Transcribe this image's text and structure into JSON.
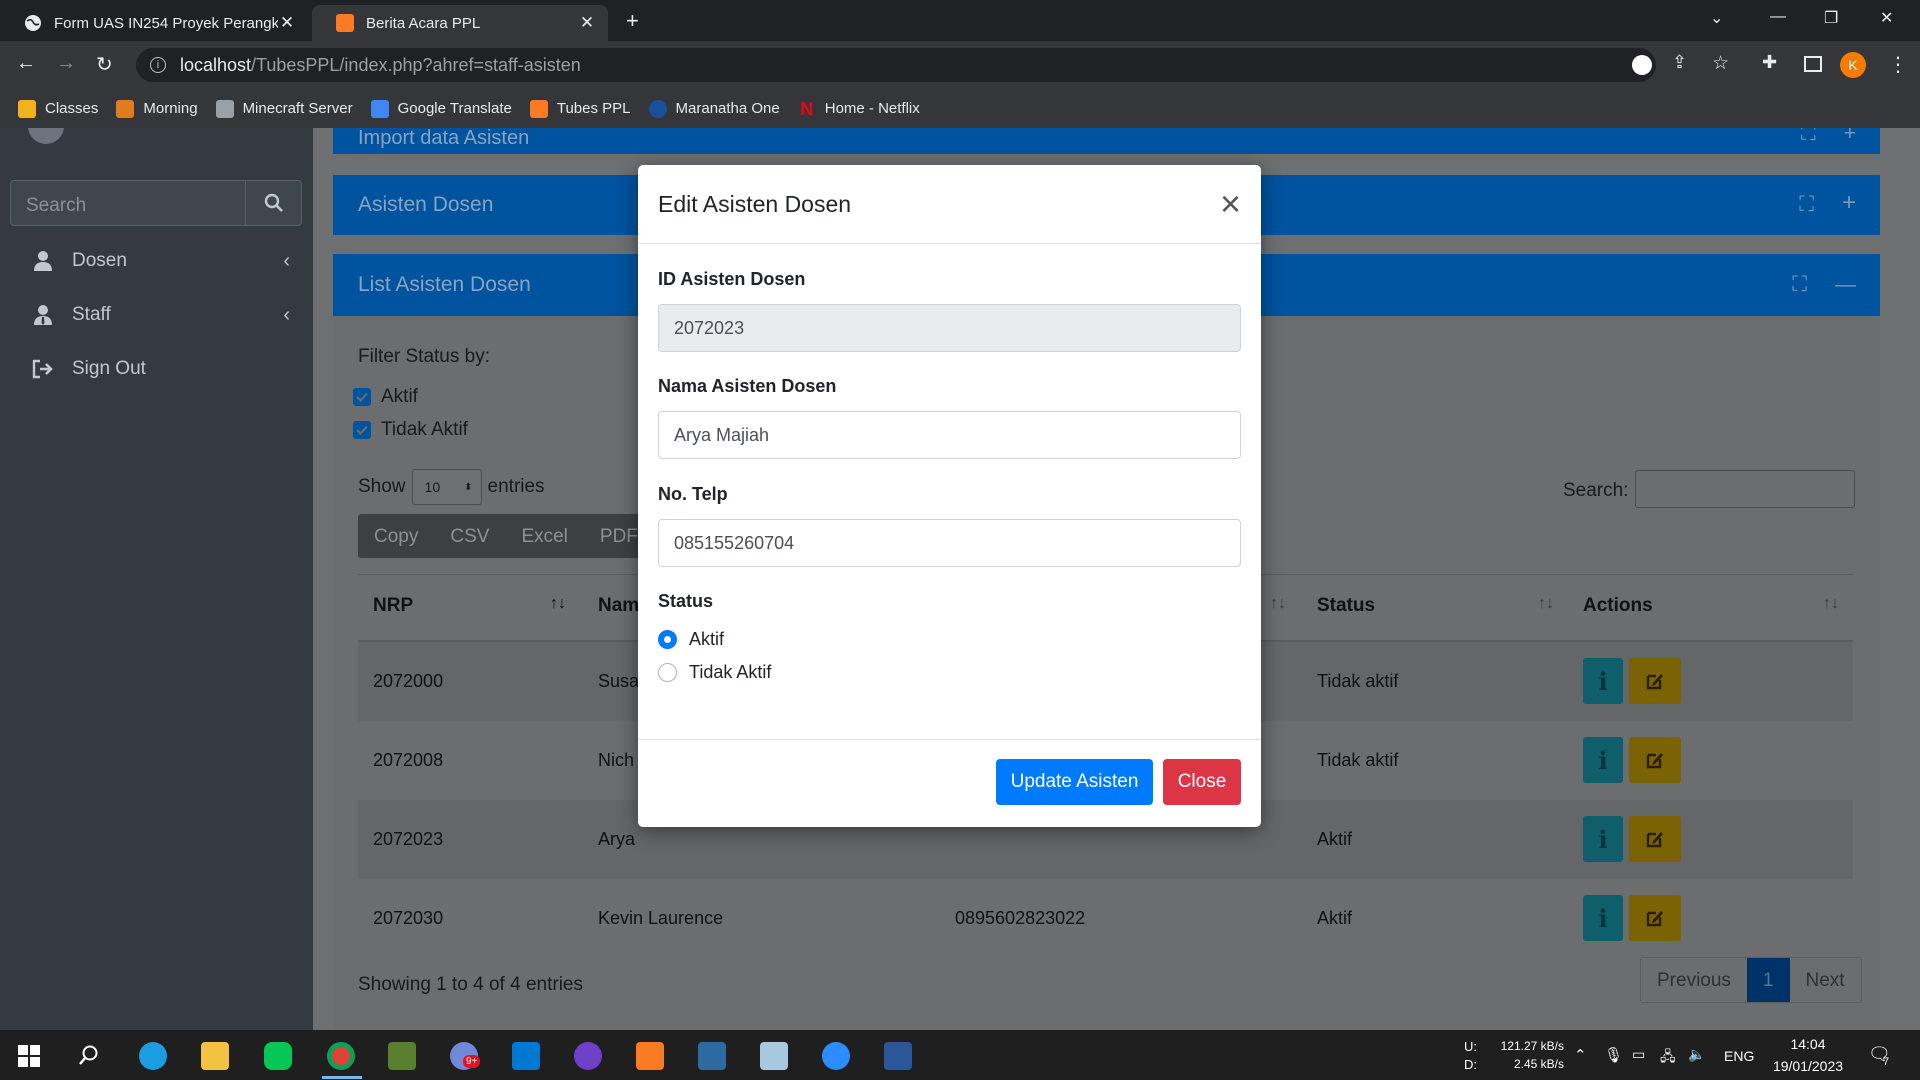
{
  "browser": {
    "tabs": [
      {
        "title": "Form UAS IN254 Proyek Perangk",
        "active": false
      },
      {
        "title": "Berita Acara PPL",
        "active": true
      }
    ],
    "url_host": "localhost",
    "url_path": "/TubesPPL/index.php?ahref=staff-asisten",
    "profile_initial": "K",
    "bookmarks": [
      "Classes",
      "Morning",
      "Minecraft Server",
      "Google Translate",
      "Tubes PPL",
      "Maranatha One",
      "Home - Netflix"
    ]
  },
  "sidebar": {
    "search_placeholder": "Search",
    "items": [
      {
        "label": "Dosen",
        "icon": "user-icon"
      },
      {
        "label": "Staff",
        "icon": "user-tie-icon"
      },
      {
        "label": "Sign Out",
        "icon": "sign-out-icon"
      }
    ]
  },
  "cards": {
    "import_title": "Import data Asisten",
    "asisten_title": "Asisten Dosen",
    "list_title": "List Asisten Dosen"
  },
  "list": {
    "filter_label": "Filter Status by:",
    "filters": [
      "Aktif",
      "Tidak Aktif"
    ],
    "show_label": "Show",
    "entries_value": "10",
    "entries_label": "entries",
    "search_label": "Search:",
    "export_buttons": [
      "Copy",
      "CSV",
      "Excel",
      "PDF"
    ],
    "columns": [
      "NRP",
      "Nama",
      "",
      "Status",
      "Actions"
    ],
    "rows": [
      {
        "nrp": "2072000",
        "nama": "Susa",
        "telp": "",
        "status": "Tidak aktif"
      },
      {
        "nrp": "2072008",
        "nama": "Nich",
        "telp": "",
        "status": "Tidak aktif"
      },
      {
        "nrp": "2072023",
        "nama": "Arya",
        "telp": "",
        "status": "Aktif"
      },
      {
        "nrp": "2072030",
        "nama": "Kevin Laurence",
        "telp": "0895602823022",
        "status": "Aktif"
      }
    ],
    "info": "Showing 1 to 4 of 4 entries",
    "pager": {
      "prev": "Previous",
      "current": "1",
      "next": "Next"
    }
  },
  "modal": {
    "title": "Edit Asisten Dosen",
    "close_glyph": "×",
    "id_label": "ID Asisten Dosen",
    "id_value": "2072023",
    "nama_label": "Nama Asisten Dosen",
    "nama_value": "Arya Majiah",
    "telp_label": "No. Telp",
    "telp_value": "085155260704",
    "status_label": "Status",
    "status_options": [
      "Aktif",
      "Tidak Aktif"
    ],
    "status_selected": "Aktif",
    "update_label": "Update Asisten",
    "close_label": "Close"
  },
  "taskbar": {
    "upload": "121.27 kB/s",
    "download": "2.45 kB/s",
    "up_label": "U:",
    "down_label": "D:",
    "lang": "ENG",
    "time": "14:04",
    "date": "19/01/2023",
    "notif_count": "7",
    "badge": "9+"
  },
  "colors": {
    "primary": "#007bff",
    "danger": "#dc3545",
    "card_header": "#0069d9",
    "sidebar": "#343a40"
  }
}
